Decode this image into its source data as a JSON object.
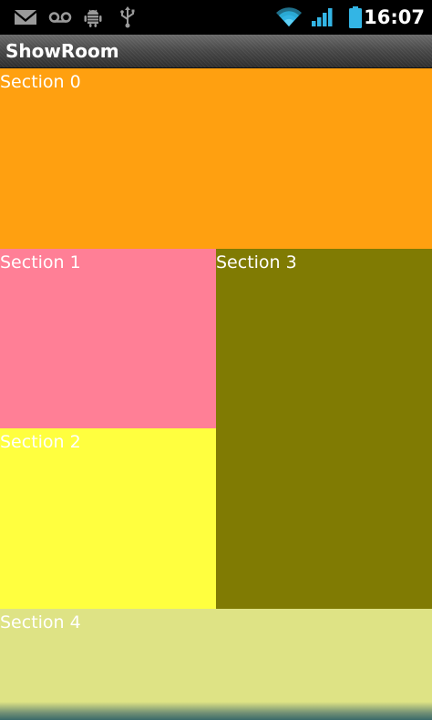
{
  "status_bar": {
    "time": "16:07",
    "icons": [
      "gmail-icon",
      "voicemail-icon",
      "android-debug-icon",
      "usb-icon",
      "wifi-icon",
      "signal-icon",
      "battery-icon"
    ],
    "icon_color": "#aaaaaa",
    "accent_color": "#33b5e5"
  },
  "title_bar": {
    "title": "ShowRoom"
  },
  "sections": [
    {
      "label": "Section 0",
      "color": "#ffa010"
    },
    {
      "label": "Section 1",
      "color": "#ff7f96"
    },
    {
      "label": "Section 2",
      "color": "#ffff3f"
    },
    {
      "label": "Section 3",
      "color": "#807b03"
    },
    {
      "label": "Section 4",
      "color": "#dee385"
    }
  ]
}
